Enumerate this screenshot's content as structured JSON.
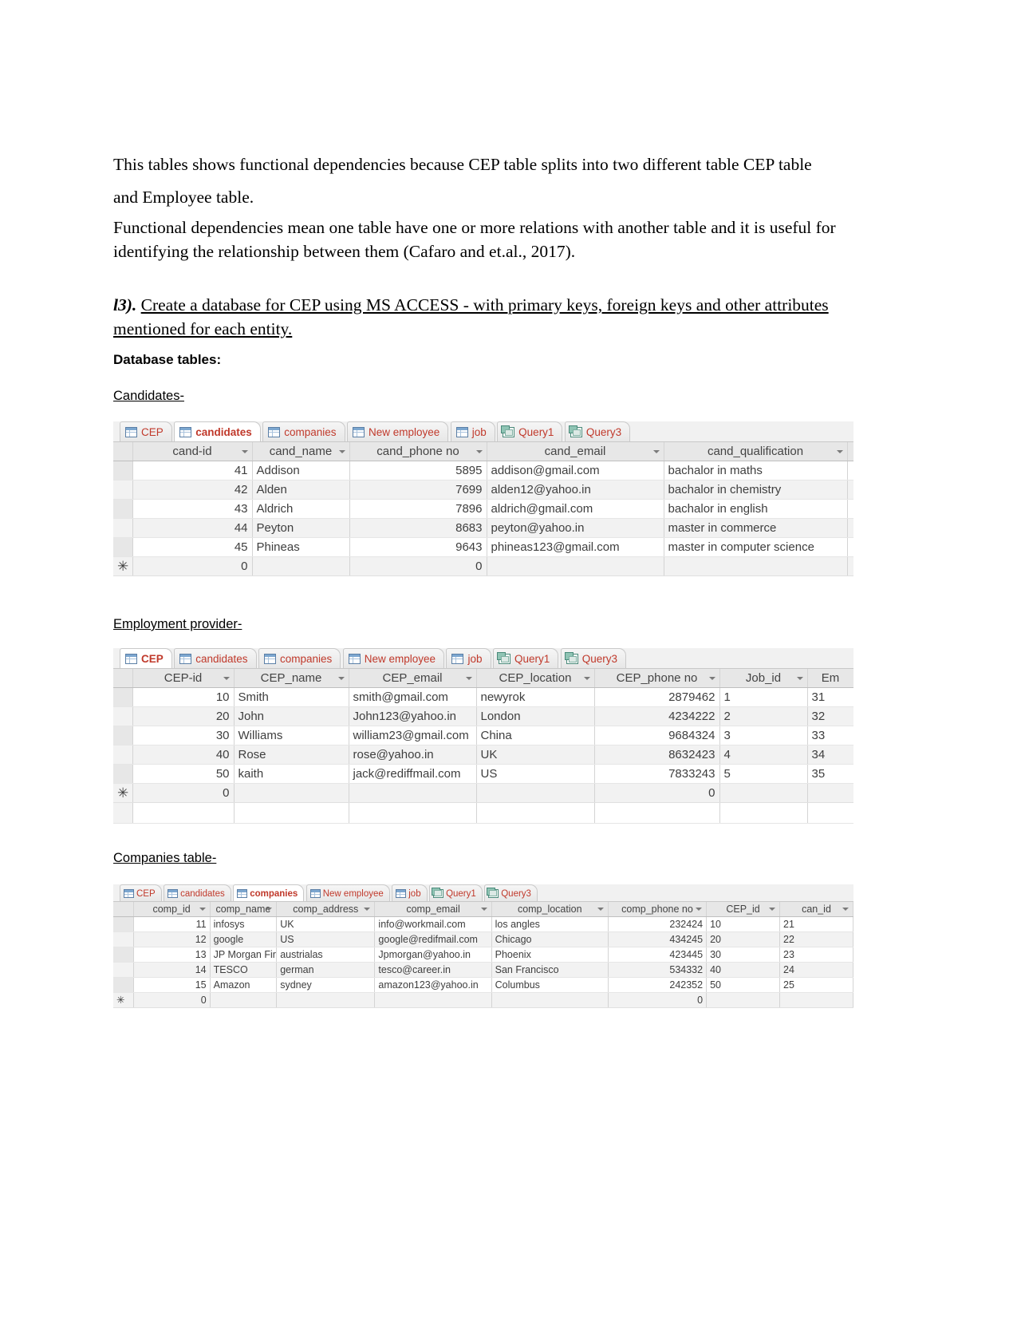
{
  "document": {
    "paragraph_1": "This tables shows functional dependencies because CEP table splits into two different table CEP table and Employee table.",
    "paragraph_2": "Functional dependencies mean one table have one or more relations with another table and it is useful for identifying the relationship between them (Cafaro and et.al., 2017).",
    "question_number": "l3).",
    "question_text": "Create a database for CEP using MS ACCESS - with primary keys, foreign keys and other attributes mentioned for each entity.",
    "database_tables_label": "Database tables:",
    "section_candidates": "Candidates-",
    "section_employment_provider": "Employment provider-",
    "section_companies": "Companies table-"
  },
  "tabs": [
    {
      "label": "CEP",
      "icon": "table-icon"
    },
    {
      "label": "candidates",
      "icon": "table-icon"
    },
    {
      "label": "companies",
      "icon": "table-icon"
    },
    {
      "label": "New employee",
      "icon": "table-icon"
    },
    {
      "label": "job",
      "icon": "table-icon"
    },
    {
      "label": "Query1",
      "icon": "query-icon"
    },
    {
      "label": "Query3",
      "icon": "query-icon"
    }
  ],
  "candidates_table": {
    "active_tab": "candidates",
    "columns": [
      "cand-id",
      "cand_name",
      "cand_phone no",
      "cand_email",
      "cand_qualification",
      ""
    ],
    "rows": [
      {
        "cand_id": "41",
        "cand_name": "Addison",
        "cand_phone_no": "5895",
        "cand_email": "addison@gmail.com",
        "cand_qualification": "bachalor in maths",
        "clipped": ""
      },
      {
        "cand_id": "42",
        "cand_name": "Alden",
        "cand_phone_no": "7699",
        "cand_email": "alden12@yahoo.in",
        "cand_qualification": "bachalor in chemistry",
        "clipped": ""
      },
      {
        "cand_id": "43",
        "cand_name": "Aldrich",
        "cand_phone_no": "7896",
        "cand_email": "aldrich@gmail.com",
        "cand_qualification": "bachalor in english",
        "clipped": ""
      },
      {
        "cand_id": "44",
        "cand_name": "Peyton",
        "cand_phone_no": "8683",
        "cand_email": "peyton@yahoo.in",
        "cand_qualification": "master in commerce",
        "clipped": ""
      },
      {
        "cand_id": "45",
        "cand_name": "Phineas",
        "cand_phone_no": "9643",
        "cand_email": "phineas123@gmail.com",
        "cand_qualification": "master in computer science",
        "clipped": ""
      }
    ],
    "new_record": {
      "marker": "✳",
      "cand_id": "0",
      "cand_name": "",
      "cand_phone_no": "0",
      "cand_email": "",
      "cand_qualification": "",
      "clipped": ""
    }
  },
  "cep_table": {
    "active_tab": "CEP",
    "columns": [
      "CEP-id",
      "CEP_name",
      "CEP_email",
      "CEP_location",
      "CEP_phone no",
      "Job_id",
      "Em"
    ],
    "rows": [
      {
        "cep_id": "10",
        "cep_name": "Smith",
        "cep_email": "smith@gmail.com",
        "cep_location": "newyrok",
        "cep_phone_no": "2879462",
        "job_id": "1",
        "em": "31"
      },
      {
        "cep_id": "20",
        "cep_name": "John",
        "cep_email": "John123@yahoo.in",
        "cep_location": "London",
        "cep_phone_no": "4234222",
        "job_id": "2",
        "em": "32"
      },
      {
        "cep_id": "30",
        "cep_name": "Williams",
        "cep_email": "william23@gmail.com",
        "cep_location": "China",
        "cep_phone_no": "9684324",
        "job_id": "3",
        "em": "33"
      },
      {
        "cep_id": "40",
        "cep_name": "Rose",
        "cep_email": "rose@yahoo.in",
        "cep_location": "UK",
        "cep_phone_no": "8632423",
        "job_id": "4",
        "em": "34"
      },
      {
        "cep_id": "50",
        "cep_name": "kaith",
        "cep_email": "jack@rediffmail.com",
        "cep_location": "US",
        "cep_phone_no": "7833243",
        "job_id": "5",
        "em": "35"
      }
    ],
    "new_record": {
      "marker": "✳",
      "cep_id": "0",
      "cep_name": "",
      "cep_email": "",
      "cep_location": "",
      "cep_phone_no": "0",
      "job_id": "",
      "em": ""
    }
  },
  "companies_table": {
    "active_tab": "companies",
    "columns": [
      "comp_id",
      "comp_name",
      "comp_address",
      "comp_email",
      "comp_location",
      "comp_phone no",
      "CEP_id",
      "can_id"
    ],
    "rows": [
      {
        "comp_id": "11",
        "comp_name": "infosys",
        "comp_address": "UK",
        "comp_email": "info@workmail.com",
        "comp_location": "los angles",
        "comp_phone_no": "232424",
        "cep_id": "10",
        "can_id": "21"
      },
      {
        "comp_id": "12",
        "comp_name": "google",
        "comp_address": "US",
        "comp_email": "google@redifmail.com",
        "comp_location": "Chicago",
        "comp_phone_no": "434245",
        "cep_id": "20",
        "can_id": "22"
      },
      {
        "comp_id": "13",
        "comp_name": "JP Morgan Firm",
        "comp_address": "austrialas",
        "comp_email": "Jpmorgan@yahoo.in",
        "comp_location": "Phoenix",
        "comp_phone_no": "423445",
        "cep_id": "30",
        "can_id": "23"
      },
      {
        "comp_id": "14",
        "comp_name": "TESCO",
        "comp_address": "german",
        "comp_email": "tesco@career.in",
        "comp_location": "San Francisco",
        "comp_phone_no": "534332",
        "cep_id": "40",
        "can_id": "24"
      },
      {
        "comp_id": "15",
        "comp_name": "Amazon",
        "comp_address": "sydney",
        "comp_email": "amazon123@yahoo.in",
        "comp_location": "Columbus",
        "comp_phone_no": "242352",
        "cep_id": "50",
        "can_id": "25"
      }
    ],
    "new_record": {
      "marker": "✳",
      "comp_id": "0",
      "comp_name": "",
      "comp_address": "",
      "comp_email": "",
      "comp_location": "",
      "comp_phone_no": "0",
      "cep_id": "",
      "can_id": ""
    }
  },
  "colors": {
    "tab_text": "#c0392b",
    "header_bg": "#e7e7e7",
    "alt_row_bg": "#f2f2f2"
  }
}
